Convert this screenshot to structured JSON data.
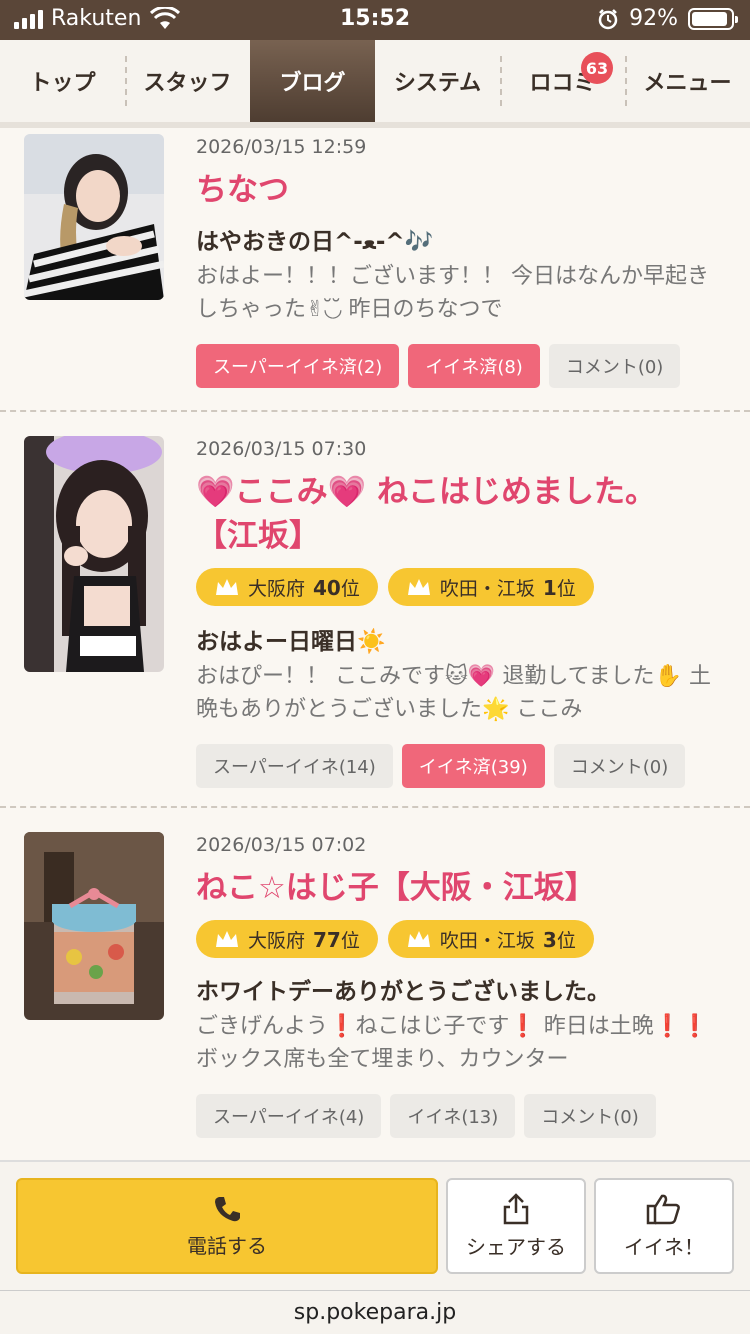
{
  "status_bar": {
    "carrier": "Rakuten",
    "time": "15:52",
    "battery": "92%",
    "battery_level": 0.92
  },
  "nav": {
    "tabs": [
      {
        "label": "トップ"
      },
      {
        "label": "スタッフ"
      },
      {
        "label": "ブログ",
        "active": true
      },
      {
        "label": "システム"
      },
      {
        "label": "ロコミ",
        "badge": "63"
      },
      {
        "label": "メニュー"
      }
    ]
  },
  "posts": [
    {
      "date": "2026/03/15 12:59",
      "title": "ちなつ",
      "subtitle": "はやおきの日^-ﻌ-^🎶",
      "excerpt": "おはよー！！！ございます！！ 今日はなんか早起きしちゃった✌︎◟̆◞̆ 昨日のちなつで",
      "actions": [
        {
          "label": "スーパーイイネ済(2)",
          "active": true
        },
        {
          "label": "イイネ済(8)",
          "active": true
        },
        {
          "label": "コメント(0)",
          "active": false
        }
      ]
    },
    {
      "date": "2026/03/15 07:30",
      "title_line1_a": "💗ここみ💗",
      "title_line1_b": "ねこはじめました。",
      "title_line2": "【江坂】",
      "ranks": [
        {
          "area": "大阪府",
          "rank": "40",
          "unit": "位"
        },
        {
          "area": "吹田・江坂",
          "rank": "1",
          "unit": "位"
        }
      ],
      "subtitle": "おはよー日曜日☀️",
      "excerpt": "おはぴー！！ ここみです🐱💗 退勤してました✋ 土晩もありがとうございました🌟 ここみ",
      "actions": [
        {
          "label": "スーパーイイネ(14)",
          "active": false
        },
        {
          "label": "イイネ済(39)",
          "active": true
        },
        {
          "label": "コメント(0)",
          "active": false
        }
      ]
    },
    {
      "date": "2026/03/15 07:02",
      "title": "ねこ☆はじ子【大阪・江坂】",
      "ranks": [
        {
          "area": "大阪府",
          "rank": "77",
          "unit": "位"
        },
        {
          "area": "吹田・江坂",
          "rank": "3",
          "unit": "位"
        }
      ],
      "subtitle": "ホワイトデーありがとうございました。",
      "excerpt": "ごきげんよう❗️ねこはじ子です❗️ 昨日は土晩❗️❗️ ボックス席も全て埋まり、カウンター",
      "actions": [
        {
          "label": "スーパーイイネ(4)",
          "active": false
        },
        {
          "label": "イイネ(13)",
          "active": false
        },
        {
          "label": "コメント(0)",
          "active": false
        }
      ]
    }
  ],
  "bottom": {
    "call": "電話する",
    "share": "シェアする",
    "like": "イイネ！"
  },
  "url": "sp.pokepara.jp",
  "colors": {
    "brand_brown": "#5a4638",
    "accent_pink": "#e0466e",
    "liked_pink": "#f0677a",
    "gold": "#f7c631"
  }
}
